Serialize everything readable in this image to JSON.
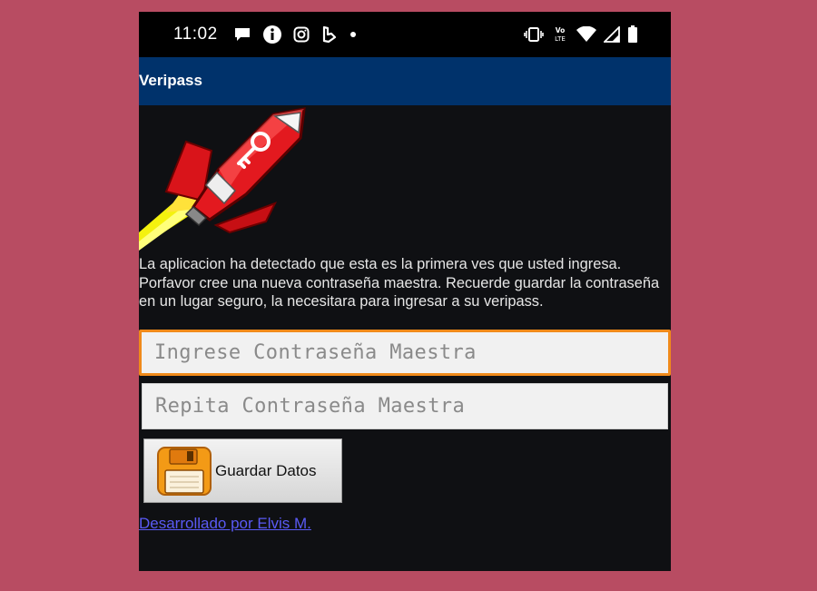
{
  "status_bar": {
    "time": "11:02",
    "left_icons": [
      "message-icon",
      "info-icon",
      "instagram-icon",
      "bing-icon",
      "dot-icon"
    ],
    "right_icons": [
      "vibrate-icon",
      "volte-icon",
      "wifi-icon",
      "signal-icon",
      "battery-icon"
    ],
    "volte_text": "Vo\nLTE"
  },
  "app_bar": {
    "title": "Veripass"
  },
  "main": {
    "message": "La aplicacion ha detectado que esta es la primera ves que usted ingresa. Porfavor cree una nueva contraseña maestra. Recuerde guardar la contraseña en un lugar seguro, la necesitara para ingresar a su veripass.",
    "password_placeholder": "Ingrese Contraseña Maestra",
    "repeat_placeholder": "Repita Contraseña Maestra",
    "save_button_label": "Guardar Datos",
    "developer_link": "Desarrollado por Elvis M."
  },
  "colors": {
    "background": "#b84c62",
    "app_bar": "#00326b",
    "focused_border": "#f08a1a",
    "link": "#5a5af5"
  }
}
